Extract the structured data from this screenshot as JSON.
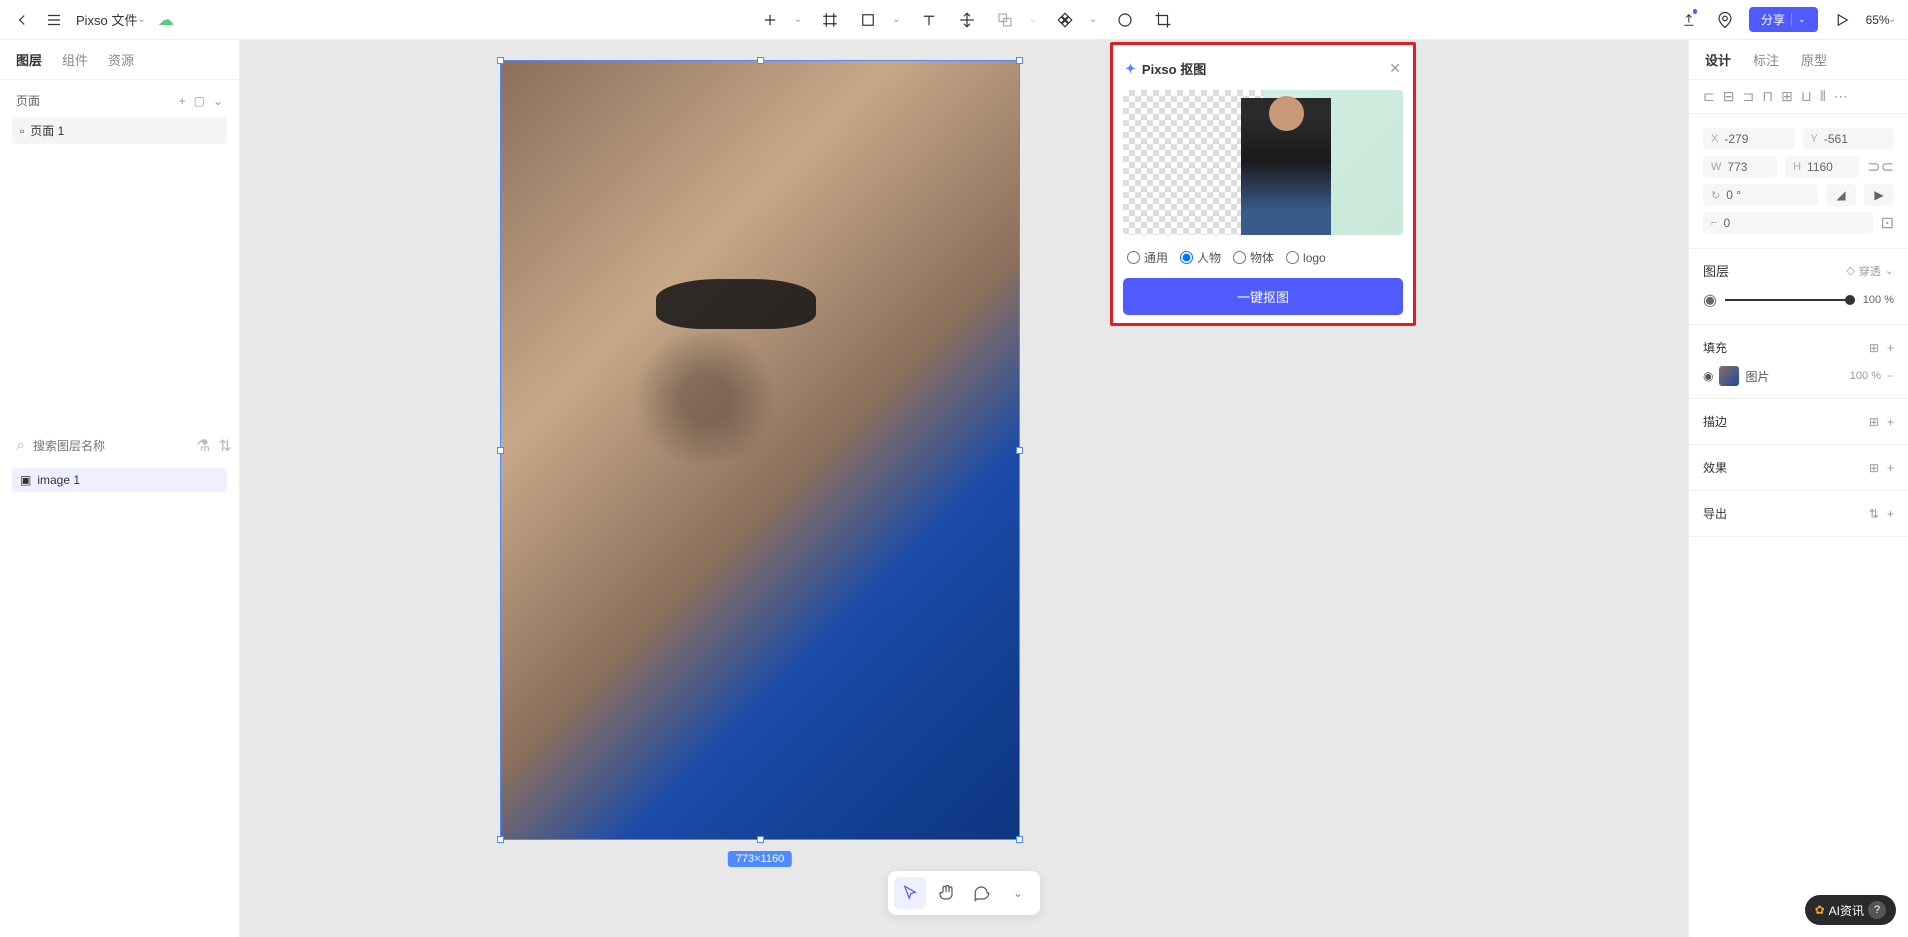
{
  "topbar": {
    "file_title": "Pixso 文件",
    "share_label": "分享",
    "zoom_label": "65%"
  },
  "left_tabs": {
    "t1": "图层",
    "t2": "组件",
    "t3": "资源"
  },
  "pages": {
    "header": "页面",
    "page1": "页面 1"
  },
  "layers": {
    "search_placeholder": "搜索图层名称",
    "layer1": "image 1"
  },
  "canvas": {
    "size_badge": "773×1160"
  },
  "cutout": {
    "title": "Pixso 抠图",
    "radio_general": "通用",
    "radio_person": "人物",
    "radio_object": "物体",
    "radio_logo": "logo",
    "button": "一键抠图"
  },
  "right_tabs": {
    "t1": "设计",
    "t2": "标注",
    "t3": "原型"
  },
  "position": {
    "x_label": "X",
    "x_value": "-279",
    "y_label": "Y",
    "y_value": "-561",
    "w_label": "W",
    "w_value": "773",
    "h_label": "H",
    "h_value": "1160",
    "rot_value": "0 °",
    "corner_value": "0"
  },
  "rp": {
    "layer_title": "图层",
    "passthrough": "穿透",
    "opacity": "100",
    "opacity_suffix": "%",
    "fill_title": "填充",
    "fill_image": "图片",
    "fill_opacity": "100",
    "fill_suffix": "%",
    "stroke_title": "描边",
    "effect_title": "效果",
    "export_title": "导出"
  },
  "help_badge": "AI资讯"
}
